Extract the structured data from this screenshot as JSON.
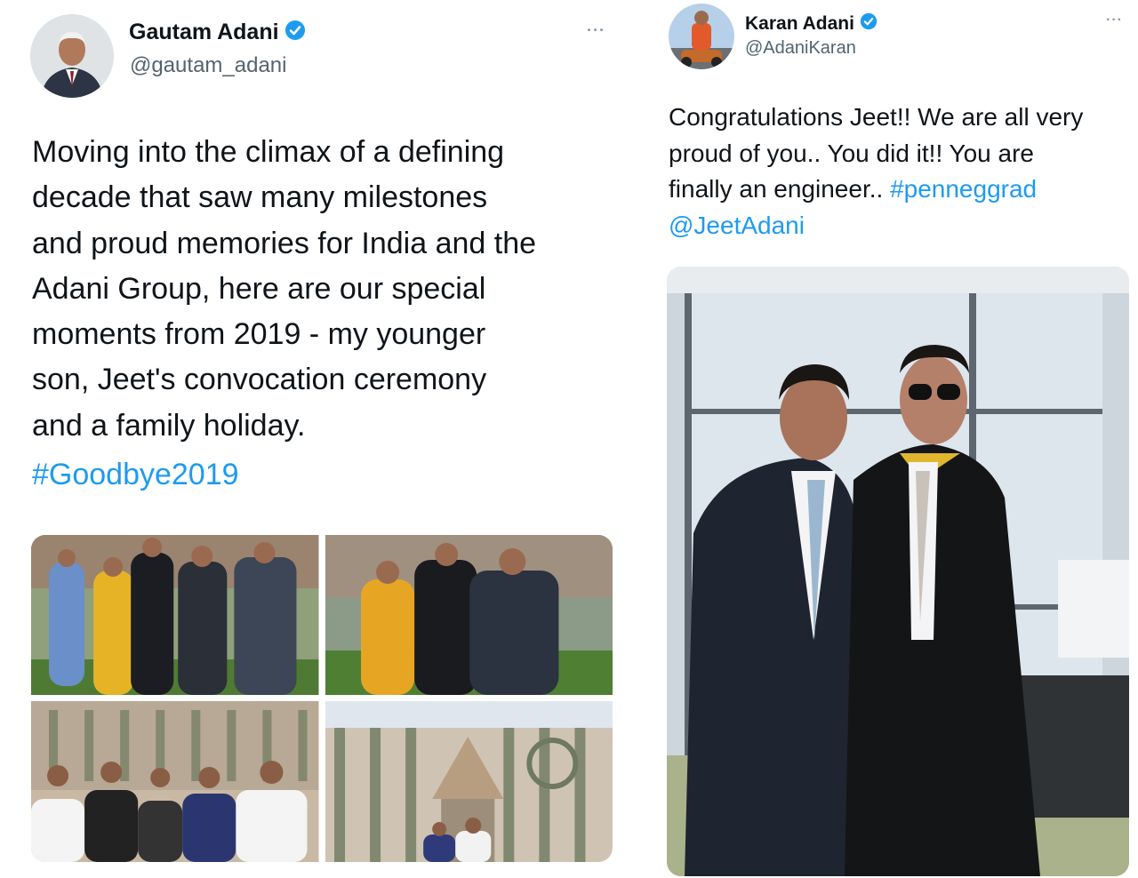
{
  "tweets": [
    {
      "author": {
        "name": "Gautam Adani",
        "handle": "@gautam_adani",
        "verified": true
      },
      "text": "Moving into the climax of a defining\ndecade that saw many milestones\nand proud memories for India and the\nAdani Group, here are our special\nmoments from 2019 - my younger\nson, Jeet's convocation ceremony\nand a family holiday.",
      "hashtag": "#Goodbye2019",
      "more_glyph": "···",
      "media": [
        {
          "icon": "photo-graduation-group"
        },
        {
          "icon": "photo-graduation-family"
        },
        {
          "icon": "photo-cathedral-family"
        },
        {
          "icon": "photo-cathedral-couple"
        }
      ]
    },
    {
      "author": {
        "name": "Karan Adani",
        "handle": "@AdaniKaran",
        "verified": true
      },
      "text_lines": [
        "Congratulations Jeet!! We are all very",
        "proud of you.. You did it!! You are",
        "finally an engineer.. "
      ],
      "hashtag": "#penneggrad",
      "mention": "@JeetAdani",
      "more_glyph": "···",
      "media": [
        {
          "icon": "photo-brothers-graduation"
        }
      ]
    }
  ],
  "colors": {
    "link": "#1d9bf0",
    "verified": "#1d9bf0",
    "text": "#0f1419",
    "secondary": "#536471"
  }
}
